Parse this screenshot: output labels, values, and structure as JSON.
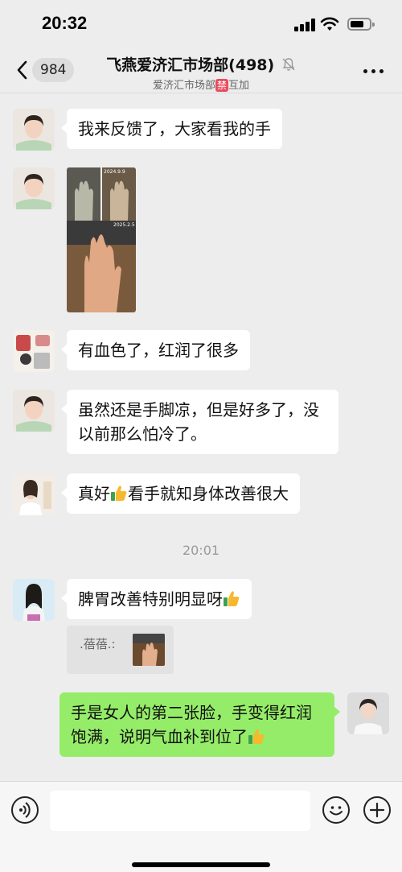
{
  "status_bar": {
    "time": "20:32"
  },
  "nav": {
    "back_count": "984",
    "title": "飞燕爱济汇市场部(498)",
    "subtitle_prefix": "爱济汇市场部",
    "subtitle_badge": "禁",
    "subtitle_suffix": "互加",
    "badge_color": "#e94b5c"
  },
  "messages": [
    {
      "side": "left",
      "text": "我来反馈了，大家看我的手"
    },
    {
      "side": "left",
      "type": "image",
      "date_labels": [
        "2024.9.9",
        "2025.2.5"
      ]
    },
    {
      "side": "left",
      "text": "有血色了，红润了很多"
    },
    {
      "side": "left",
      "text": "虽然还是手脚凉，但是好多了，没以前那么怕冷了。"
    },
    {
      "side": "left",
      "text_before": "真好",
      "emoji": "thumbs-up",
      "text_after": "看手就知身体改善很大"
    },
    {
      "side": "left",
      "text": "脾胃改善特别明显呀",
      "emoji": "thumbs-up"
    },
    {
      "side": "right",
      "text": "手是女人的第二张脸，手变得红润饱满，说明气血补到位了",
      "emoji": "thumbs-up"
    }
  ],
  "timestamp": "20:01",
  "quote": {
    "sender": ".蓓蓓.:"
  },
  "colors": {
    "bubble_self": "#95ec69",
    "bubble_other": "#ffffff",
    "background": "#ededed"
  }
}
